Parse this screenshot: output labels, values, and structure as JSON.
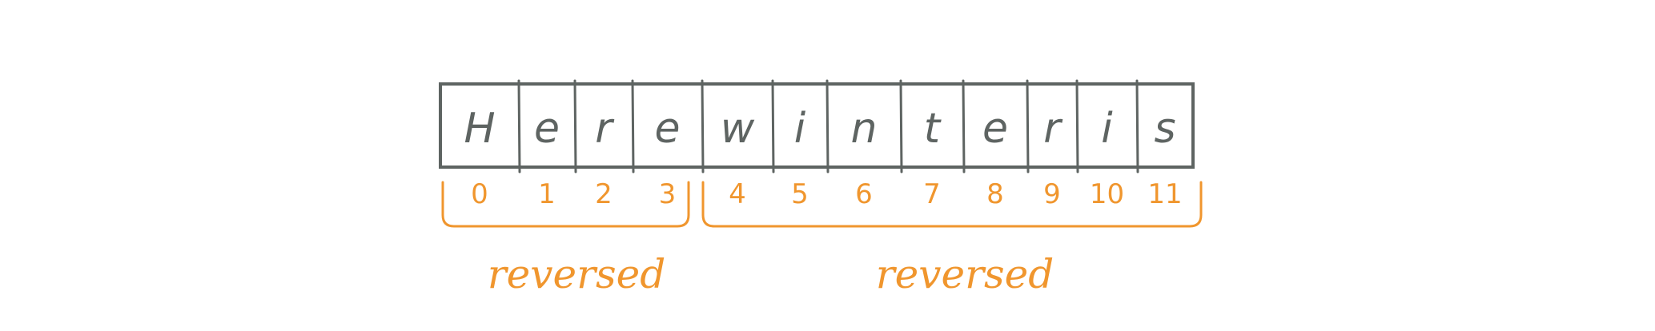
{
  "characters": [
    "H",
    "e",
    "r",
    "e",
    "w",
    "i",
    "n",
    "t",
    "e",
    "r",
    "i",
    "s"
  ],
  "indices": [
    "0",
    "1",
    "2",
    "3",
    "4",
    "5",
    "6",
    "7",
    "8",
    "9",
    "10",
    "11"
  ],
  "groups": [
    {
      "label": "reversed",
      "start_index": 0,
      "end_index": 3
    },
    {
      "label": "reversed",
      "start_index": 4,
      "end_index": 11
    }
  ],
  "colors": {
    "cell_stroke": "#5e6462",
    "annotation": "#f0962e",
    "background": "#ffffff"
  }
}
